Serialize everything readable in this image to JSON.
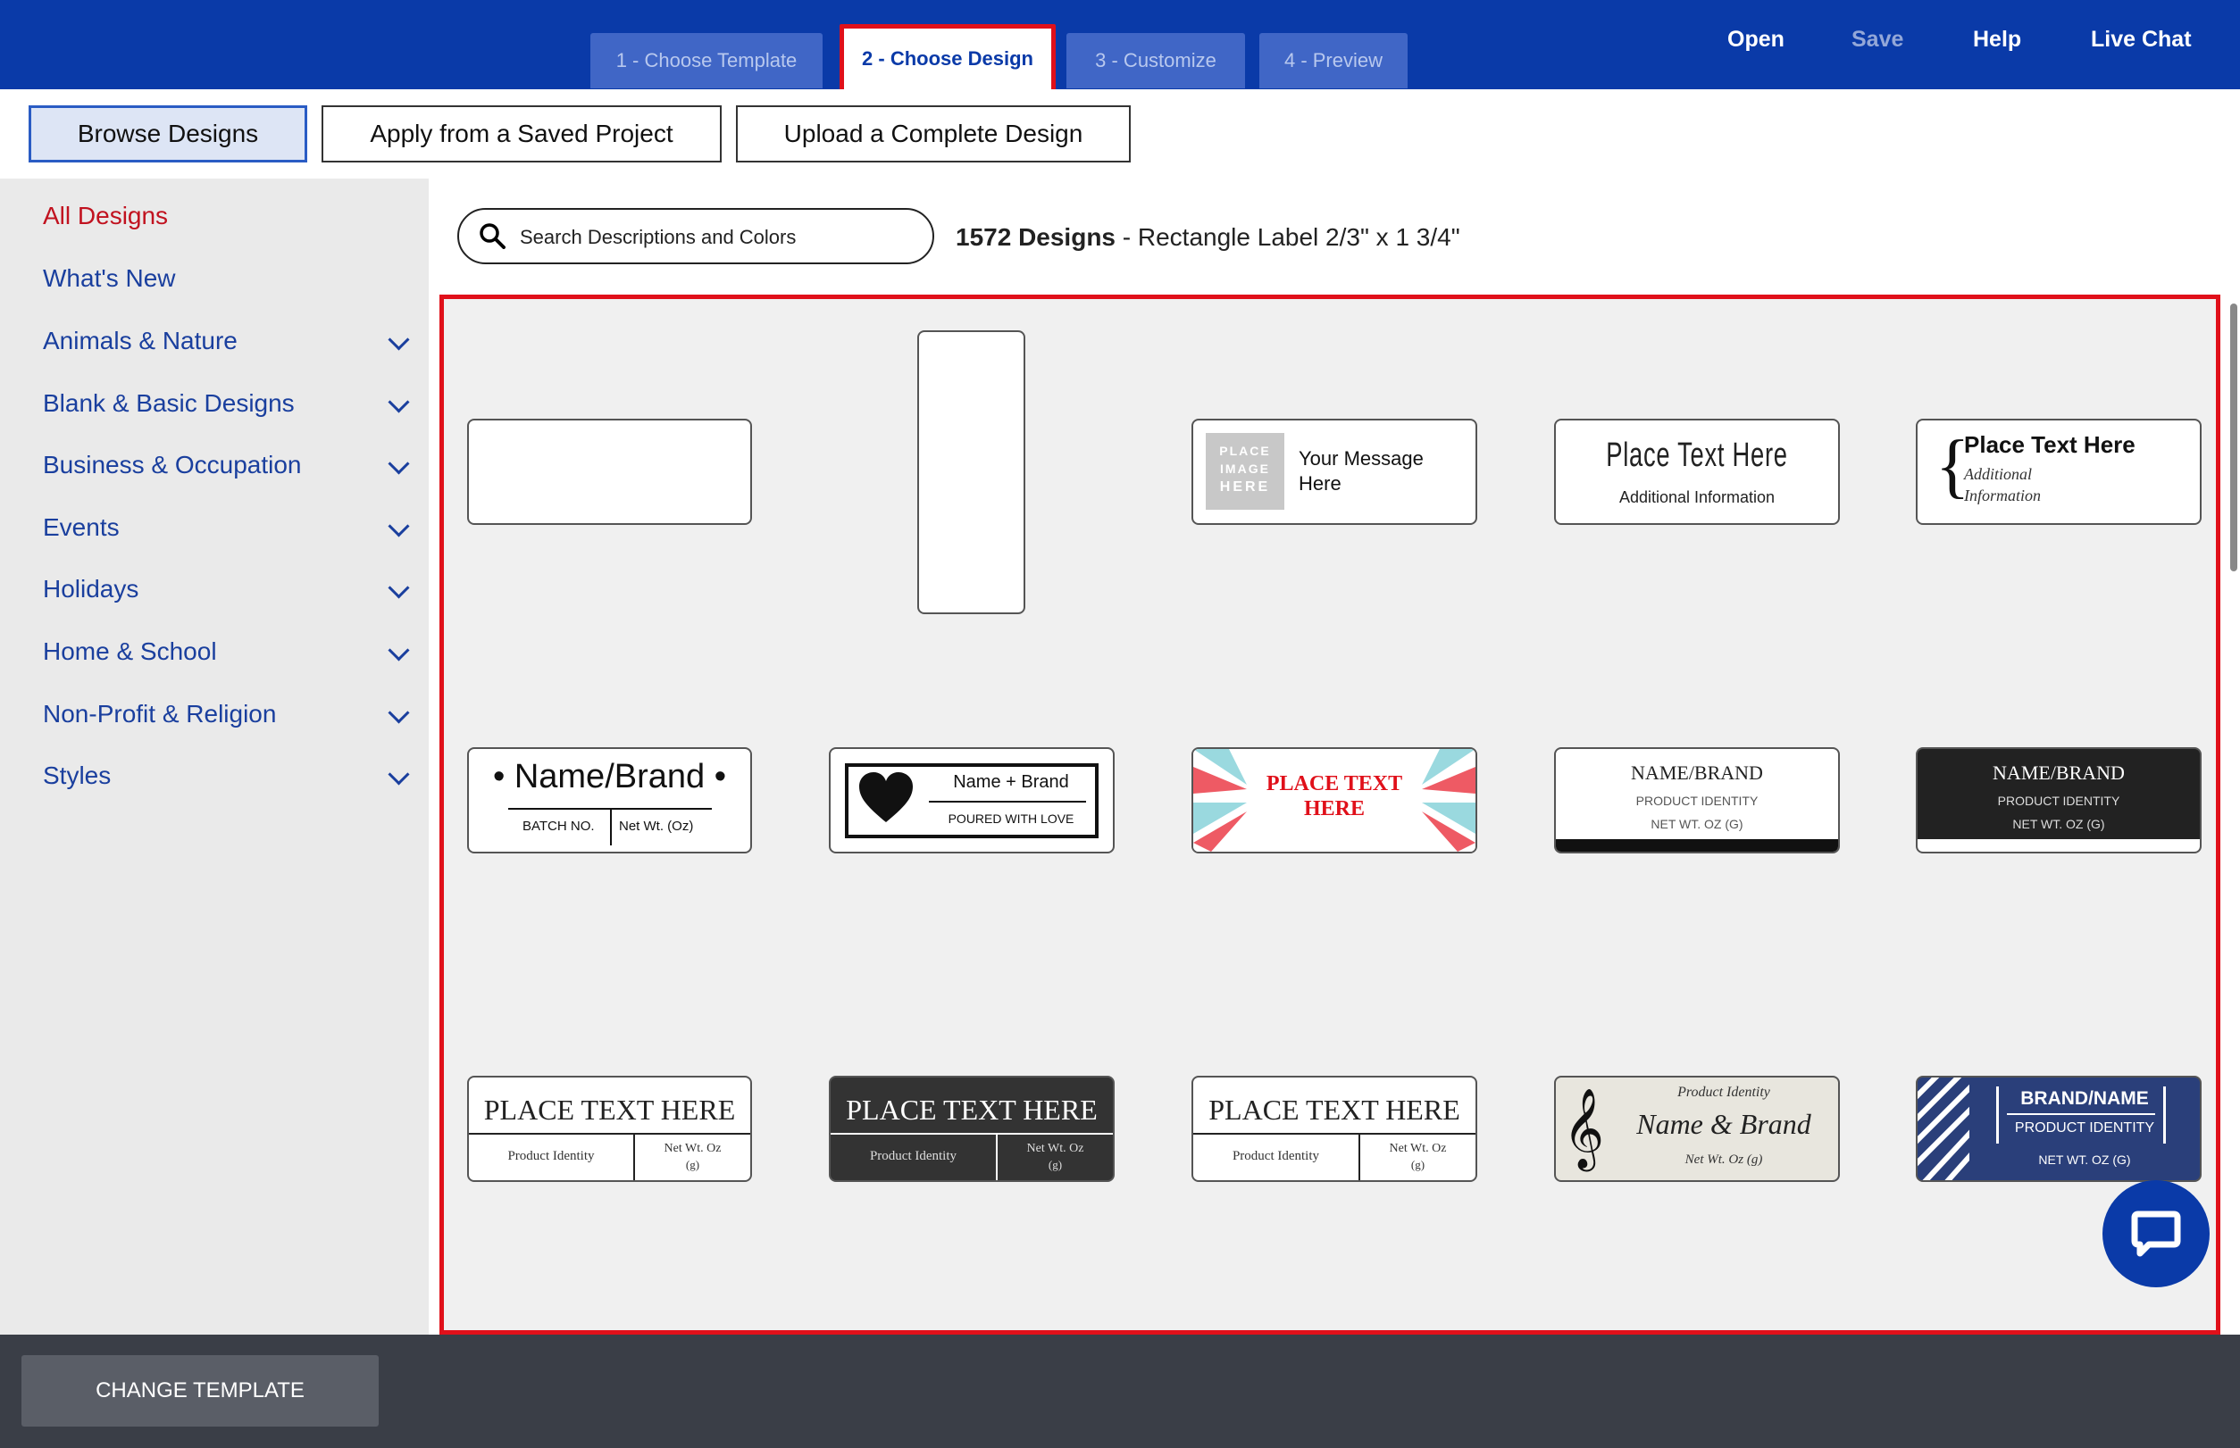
{
  "steps": [
    "1 - Choose Template",
    "2 - Choose Design",
    "3 - Customize",
    "4 - Preview"
  ],
  "topnav": {
    "open": "Open",
    "save": "Save",
    "help": "Help",
    "live_chat": "Live Chat"
  },
  "tabs": {
    "browse": "Browse Designs",
    "apply": "Apply from a Saved Project",
    "upload": "Upload a Complete Design"
  },
  "sidebar": [
    "All Designs",
    "What's New",
    "Animals & Nature",
    "Blank & Basic Designs",
    "Business & Occupation",
    "Events",
    "Holidays",
    "Home & School",
    "Non-Profit & Religion",
    "Styles"
  ],
  "search": {
    "placeholder": "Search Descriptions and Colors"
  },
  "results": {
    "count": "1572 Designs",
    "template": " - Rectangle Label 2/3\" x 1 3/4\""
  },
  "designs": {
    "d3": {
      "img": [
        "PLACE",
        "IMAGE",
        "HERE"
      ],
      "msg1": "Your Message",
      "msg2": "Here"
    },
    "d4": {
      "title": "Place Text Here",
      "sub": "Additional Information"
    },
    "d5": {
      "title": "Place Text Here",
      "sub1": "Additional",
      "sub2": "Information"
    },
    "d6": {
      "title": "Name/Brand",
      "left": "BATCH NO.",
      "right": "Net Wt. (Oz)"
    },
    "d7": {
      "title": "Name + Brand",
      "sub": "POURED WITH LOVE"
    },
    "d8": {
      "title1": "PLACE TEXT",
      "title2": "HERE"
    },
    "d9": {
      "title": "NAME/BRAND",
      "sub1": "PRODUCT IDENTITY",
      "sub2": "NET WT. OZ (G)"
    },
    "d10": {
      "title": "NAME/BRAND",
      "sub1": "PRODUCT IDENTITY",
      "sub2": "NET WT. OZ (G)"
    },
    "d11": {
      "title": "PLACE TEXT HERE",
      "left": "Product Identity",
      "right1": "Net Wt. Oz",
      "right2": "(g)"
    },
    "d12": {
      "title": "PLACE TEXT HERE",
      "left": "Product Identity",
      "right1": "Net Wt. Oz",
      "right2": "(g)"
    },
    "d13": {
      "title": "PLACE TEXT HERE",
      "left": "Product Identity",
      "right1": "Net Wt. Oz",
      "right2": "(g)"
    },
    "d14": {
      "top": "Product Identity",
      "title": "Name & Brand",
      "bottom": "Net Wt. Oz (g)"
    },
    "d15": {
      "title": "BRAND/NAME",
      "sub1": "PRODUCT IDENTITY",
      "sub2": "NET WT. OZ (G)"
    }
  },
  "bottom": {
    "change_template": "CHANGE TEMPLATE"
  },
  "colors": {
    "brand_blue": "#0a3aa8",
    "highlight_red": "#e0101a",
    "link_blue": "#1a3f9e",
    "selected_red": "#c1121f"
  },
  "icons": [
    "search-icon",
    "chevron-down-icon",
    "treble-clef-icon",
    "heart-icon",
    "chat-bubble-icon"
  ]
}
